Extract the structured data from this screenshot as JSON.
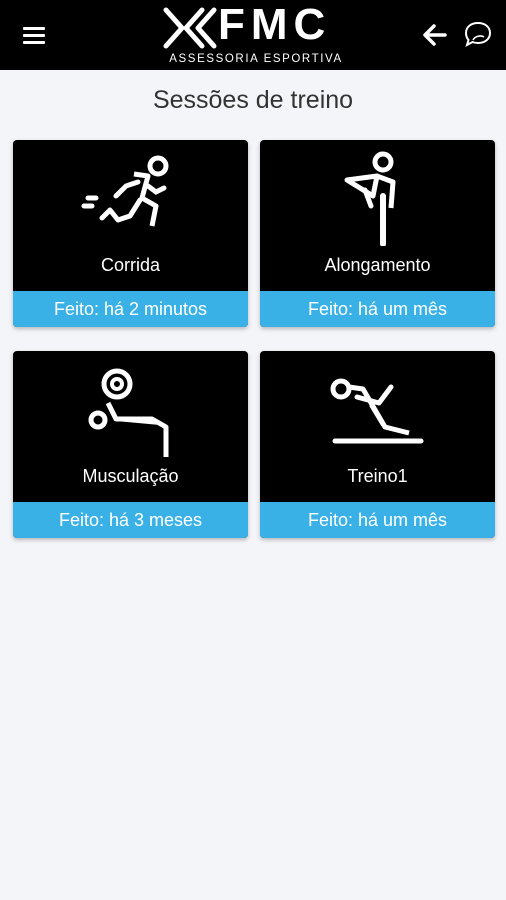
{
  "header": {
    "logo_text": "FMC",
    "logo_subtitle": "ASSESSORIA ESPORTIVA",
    "menu_icon": "hamburger-menu-icon",
    "back_icon": "arrow-left-icon",
    "chat_icon": "chat-bubbles-icon",
    "background": "#000000"
  },
  "page": {
    "title": "Sessões de treino"
  },
  "accent": "#3ab1e6",
  "sessions": [
    {
      "name": "Corrida",
      "status": "Feito: há 2 minutos",
      "icon": "running-person-icon"
    },
    {
      "name": "Alongamento",
      "status": "Feito: há um mês",
      "icon": "stretching-person-icon"
    },
    {
      "name": "Musculação",
      "status": "Feito: há 3 meses",
      "icon": "weightlifting-bench-icon"
    },
    {
      "name": "Treino1",
      "status": "Feito: há um mês",
      "icon": "incline-situp-icon"
    }
  ]
}
